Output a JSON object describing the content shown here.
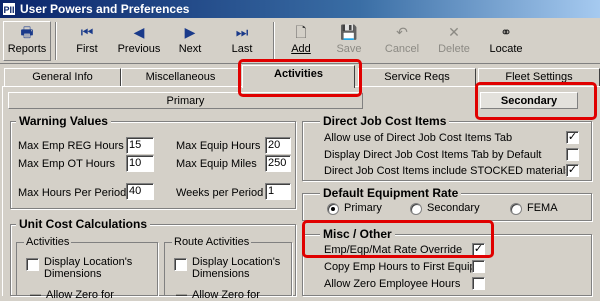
{
  "window": {
    "title": "User Powers and Preferences",
    "app_icon_text": "PII"
  },
  "toolbar": {
    "reports": "Reports",
    "first": "First",
    "previous": "Previous",
    "next": "Next",
    "last": "Last",
    "add": "Add",
    "save": "Save",
    "cancel": "Cancel",
    "delete": "Delete",
    "locate": "Locate"
  },
  "tabs": [
    "General Info",
    "Miscellaneous",
    "Activities",
    "Service Reqs",
    "Fleet Settings"
  ],
  "active_tab": "Activities",
  "subtabs": {
    "primary": "Primary",
    "secondary": "Secondary"
  },
  "warning": {
    "title": "Warning Values",
    "max_emp_reg_label": "Max Emp REG Hours",
    "max_emp_reg_value": "15",
    "max_emp_ot_label": "Max Emp OT Hours",
    "max_emp_ot_value": "10",
    "max_hours_period_label": "Max Hours Per Period",
    "max_hours_period_value": "40",
    "max_equip_hours_label": "Max Equip Hours",
    "max_equip_hours_value": "20",
    "max_equip_miles_label": "Max Equip Miles",
    "max_equip_miles_value": "250",
    "weeks_period_label": "Weeks per Period",
    "weeks_period_value": "1"
  },
  "unit_cost": {
    "title": "Unit Cost Calculations",
    "activities_title": "Activities",
    "route_activities_title": "Route Activities",
    "display_location": "Display Location's Dimensions",
    "allow_zero": "Allow Zero for"
  },
  "direct_job": {
    "title": "Direct Job Cost Items",
    "items": [
      {
        "label": "Allow use of Direct Job Cost Items Tab",
        "checked": true
      },
      {
        "label": "Display Direct Job Cost Items Tab by Default",
        "checked": false
      },
      {
        "label": "Direct Job Cost Items include STOCKED materials",
        "checked": true
      }
    ]
  },
  "equip_rate": {
    "title": "Default Equipment Rate",
    "options": [
      "Primary",
      "Secondary",
      "FEMA"
    ],
    "selected": "Primary"
  },
  "misc_other": {
    "title": "Misc / Other",
    "items": [
      {
        "label": "Emp/Eqp/Mat Rate Override",
        "checked": true
      },
      {
        "label": "Copy Emp Hours to First Equip",
        "checked": false
      },
      {
        "label": "Allow Zero Employee Hours",
        "checked": false
      }
    ]
  },
  "colors": {
    "highlight": "#e00000",
    "title_bar": "#0a246a",
    "face": "#d4d0c8"
  }
}
